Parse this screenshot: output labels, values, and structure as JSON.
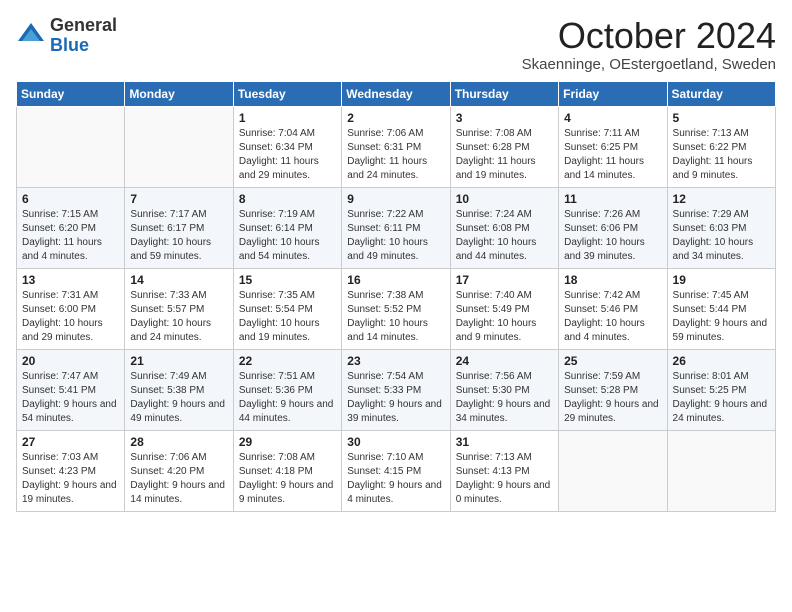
{
  "logo": {
    "general": "General",
    "blue": "Blue"
  },
  "header": {
    "month": "October 2024",
    "location": "Skaenninge, OEstergoetland, Sweden"
  },
  "weekdays": [
    "Sunday",
    "Monday",
    "Tuesday",
    "Wednesday",
    "Thursday",
    "Friday",
    "Saturday"
  ],
  "weeks": [
    [
      {
        "day": "",
        "info": ""
      },
      {
        "day": "",
        "info": ""
      },
      {
        "day": "1",
        "info": "Sunrise: 7:04 AM\nSunset: 6:34 PM\nDaylight: 11 hours and 29 minutes."
      },
      {
        "day": "2",
        "info": "Sunrise: 7:06 AM\nSunset: 6:31 PM\nDaylight: 11 hours and 24 minutes."
      },
      {
        "day": "3",
        "info": "Sunrise: 7:08 AM\nSunset: 6:28 PM\nDaylight: 11 hours and 19 minutes."
      },
      {
        "day": "4",
        "info": "Sunrise: 7:11 AM\nSunset: 6:25 PM\nDaylight: 11 hours and 14 minutes."
      },
      {
        "day": "5",
        "info": "Sunrise: 7:13 AM\nSunset: 6:22 PM\nDaylight: 11 hours and 9 minutes."
      }
    ],
    [
      {
        "day": "6",
        "info": "Sunrise: 7:15 AM\nSunset: 6:20 PM\nDaylight: 11 hours and 4 minutes."
      },
      {
        "day": "7",
        "info": "Sunrise: 7:17 AM\nSunset: 6:17 PM\nDaylight: 10 hours and 59 minutes."
      },
      {
        "day": "8",
        "info": "Sunrise: 7:19 AM\nSunset: 6:14 PM\nDaylight: 10 hours and 54 minutes."
      },
      {
        "day": "9",
        "info": "Sunrise: 7:22 AM\nSunset: 6:11 PM\nDaylight: 10 hours and 49 minutes."
      },
      {
        "day": "10",
        "info": "Sunrise: 7:24 AM\nSunset: 6:08 PM\nDaylight: 10 hours and 44 minutes."
      },
      {
        "day": "11",
        "info": "Sunrise: 7:26 AM\nSunset: 6:06 PM\nDaylight: 10 hours and 39 minutes."
      },
      {
        "day": "12",
        "info": "Sunrise: 7:29 AM\nSunset: 6:03 PM\nDaylight: 10 hours and 34 minutes."
      }
    ],
    [
      {
        "day": "13",
        "info": "Sunrise: 7:31 AM\nSunset: 6:00 PM\nDaylight: 10 hours and 29 minutes."
      },
      {
        "day": "14",
        "info": "Sunrise: 7:33 AM\nSunset: 5:57 PM\nDaylight: 10 hours and 24 minutes."
      },
      {
        "day": "15",
        "info": "Sunrise: 7:35 AM\nSunset: 5:54 PM\nDaylight: 10 hours and 19 minutes."
      },
      {
        "day": "16",
        "info": "Sunrise: 7:38 AM\nSunset: 5:52 PM\nDaylight: 10 hours and 14 minutes."
      },
      {
        "day": "17",
        "info": "Sunrise: 7:40 AM\nSunset: 5:49 PM\nDaylight: 10 hours and 9 minutes."
      },
      {
        "day": "18",
        "info": "Sunrise: 7:42 AM\nSunset: 5:46 PM\nDaylight: 10 hours and 4 minutes."
      },
      {
        "day": "19",
        "info": "Sunrise: 7:45 AM\nSunset: 5:44 PM\nDaylight: 9 hours and 59 minutes."
      }
    ],
    [
      {
        "day": "20",
        "info": "Sunrise: 7:47 AM\nSunset: 5:41 PM\nDaylight: 9 hours and 54 minutes."
      },
      {
        "day": "21",
        "info": "Sunrise: 7:49 AM\nSunset: 5:38 PM\nDaylight: 9 hours and 49 minutes."
      },
      {
        "day": "22",
        "info": "Sunrise: 7:51 AM\nSunset: 5:36 PM\nDaylight: 9 hours and 44 minutes."
      },
      {
        "day": "23",
        "info": "Sunrise: 7:54 AM\nSunset: 5:33 PM\nDaylight: 9 hours and 39 minutes."
      },
      {
        "day": "24",
        "info": "Sunrise: 7:56 AM\nSunset: 5:30 PM\nDaylight: 9 hours and 34 minutes."
      },
      {
        "day": "25",
        "info": "Sunrise: 7:59 AM\nSunset: 5:28 PM\nDaylight: 9 hours and 29 minutes."
      },
      {
        "day": "26",
        "info": "Sunrise: 8:01 AM\nSunset: 5:25 PM\nDaylight: 9 hours and 24 minutes."
      }
    ],
    [
      {
        "day": "27",
        "info": "Sunrise: 7:03 AM\nSunset: 4:23 PM\nDaylight: 9 hours and 19 minutes."
      },
      {
        "day": "28",
        "info": "Sunrise: 7:06 AM\nSunset: 4:20 PM\nDaylight: 9 hours and 14 minutes."
      },
      {
        "day": "29",
        "info": "Sunrise: 7:08 AM\nSunset: 4:18 PM\nDaylight: 9 hours and 9 minutes."
      },
      {
        "day": "30",
        "info": "Sunrise: 7:10 AM\nSunset: 4:15 PM\nDaylight: 9 hours and 4 minutes."
      },
      {
        "day": "31",
        "info": "Sunrise: 7:13 AM\nSunset: 4:13 PM\nDaylight: 9 hours and 0 minutes."
      },
      {
        "day": "",
        "info": ""
      },
      {
        "day": "",
        "info": ""
      }
    ]
  ]
}
